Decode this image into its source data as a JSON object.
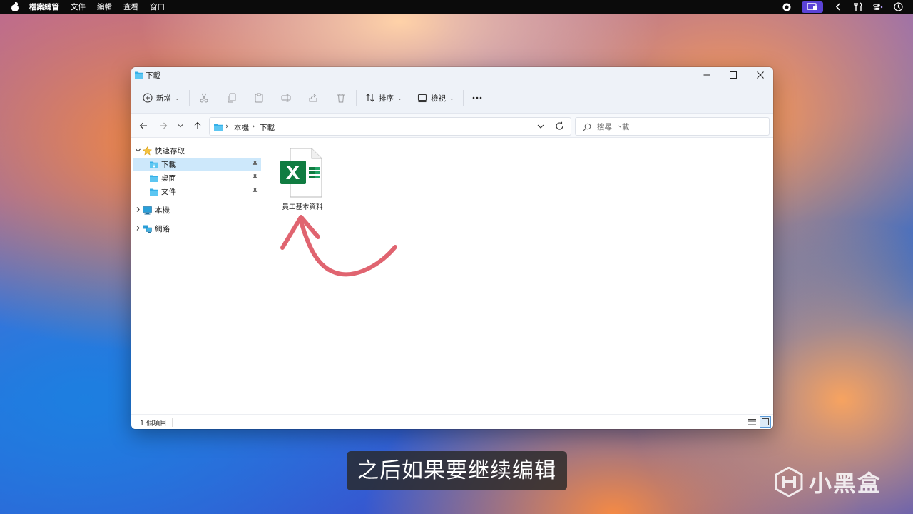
{
  "menubar": {
    "app_name": "檔案總管",
    "items": [
      "文件",
      "編輯",
      "查看",
      "窗口"
    ]
  },
  "window": {
    "title": "下載",
    "controls": [
      "minimize-icon",
      "maximize-icon",
      "close-icon"
    ]
  },
  "toolbar": {
    "new_label": "新增",
    "sort_label": "排序",
    "view_label": "檢視",
    "icons": [
      "cut-icon",
      "copy-icon",
      "paste-icon",
      "rename-icon",
      "share-icon",
      "delete-icon"
    ]
  },
  "address": {
    "crumbs": [
      "本機",
      "下載"
    ],
    "search_placeholder": "搜尋 下載"
  },
  "sidebar": {
    "quick_access": "快速存取",
    "items": [
      {
        "label": "下載",
        "selected": true
      },
      {
        "label": "桌面",
        "selected": false
      },
      {
        "label": "文件",
        "selected": false
      }
    ],
    "this_pc": "本機",
    "network": "網路"
  },
  "content": {
    "files": [
      {
        "name": "員工基本資料",
        "type": "excel"
      }
    ]
  },
  "status": {
    "count_text": "1 個項目"
  },
  "overlay": {
    "subtitle": "之后如果要继续编辑",
    "brand": "小黑盒",
    "arrow_color": "#e06470"
  },
  "colors": {
    "accent": "#0067c0",
    "selection": "#cde8fb",
    "excel_green": "#107c41",
    "folder": "#35b0e8"
  }
}
